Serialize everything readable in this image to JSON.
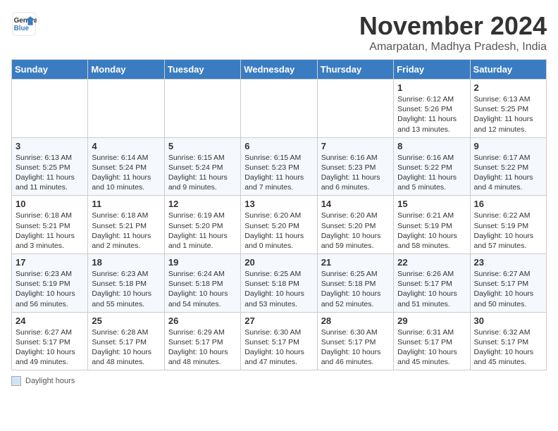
{
  "header": {
    "logo_line1": "General",
    "logo_line2": "Blue",
    "title": "November 2024",
    "subtitle": "Amarpatan, Madhya Pradesh, India"
  },
  "weekdays": [
    "Sunday",
    "Monday",
    "Tuesday",
    "Wednesday",
    "Thursday",
    "Friday",
    "Saturday"
  ],
  "weeks": [
    [
      {
        "day": "",
        "info": ""
      },
      {
        "day": "",
        "info": ""
      },
      {
        "day": "",
        "info": ""
      },
      {
        "day": "",
        "info": ""
      },
      {
        "day": "",
        "info": ""
      },
      {
        "day": "1",
        "info": "Sunrise: 6:12 AM\nSunset: 5:26 PM\nDaylight: 11 hours and 13 minutes."
      },
      {
        "day": "2",
        "info": "Sunrise: 6:13 AM\nSunset: 5:25 PM\nDaylight: 11 hours and 12 minutes."
      }
    ],
    [
      {
        "day": "3",
        "info": "Sunrise: 6:13 AM\nSunset: 5:25 PM\nDaylight: 11 hours and 11 minutes."
      },
      {
        "day": "4",
        "info": "Sunrise: 6:14 AM\nSunset: 5:24 PM\nDaylight: 11 hours and 10 minutes."
      },
      {
        "day": "5",
        "info": "Sunrise: 6:15 AM\nSunset: 5:24 PM\nDaylight: 11 hours and 9 minutes."
      },
      {
        "day": "6",
        "info": "Sunrise: 6:15 AM\nSunset: 5:23 PM\nDaylight: 11 hours and 7 minutes."
      },
      {
        "day": "7",
        "info": "Sunrise: 6:16 AM\nSunset: 5:23 PM\nDaylight: 11 hours and 6 minutes."
      },
      {
        "day": "8",
        "info": "Sunrise: 6:16 AM\nSunset: 5:22 PM\nDaylight: 11 hours and 5 minutes."
      },
      {
        "day": "9",
        "info": "Sunrise: 6:17 AM\nSunset: 5:22 PM\nDaylight: 11 hours and 4 minutes."
      }
    ],
    [
      {
        "day": "10",
        "info": "Sunrise: 6:18 AM\nSunset: 5:21 PM\nDaylight: 11 hours and 3 minutes."
      },
      {
        "day": "11",
        "info": "Sunrise: 6:18 AM\nSunset: 5:21 PM\nDaylight: 11 hours and 2 minutes."
      },
      {
        "day": "12",
        "info": "Sunrise: 6:19 AM\nSunset: 5:20 PM\nDaylight: 11 hours and 1 minute."
      },
      {
        "day": "13",
        "info": "Sunrise: 6:20 AM\nSunset: 5:20 PM\nDaylight: 11 hours and 0 minutes."
      },
      {
        "day": "14",
        "info": "Sunrise: 6:20 AM\nSunset: 5:20 PM\nDaylight: 10 hours and 59 minutes."
      },
      {
        "day": "15",
        "info": "Sunrise: 6:21 AM\nSunset: 5:19 PM\nDaylight: 10 hours and 58 minutes."
      },
      {
        "day": "16",
        "info": "Sunrise: 6:22 AM\nSunset: 5:19 PM\nDaylight: 10 hours and 57 minutes."
      }
    ],
    [
      {
        "day": "17",
        "info": "Sunrise: 6:23 AM\nSunset: 5:19 PM\nDaylight: 10 hours and 56 minutes."
      },
      {
        "day": "18",
        "info": "Sunrise: 6:23 AM\nSunset: 5:18 PM\nDaylight: 10 hours and 55 minutes."
      },
      {
        "day": "19",
        "info": "Sunrise: 6:24 AM\nSunset: 5:18 PM\nDaylight: 10 hours and 54 minutes."
      },
      {
        "day": "20",
        "info": "Sunrise: 6:25 AM\nSunset: 5:18 PM\nDaylight: 10 hours and 53 minutes."
      },
      {
        "day": "21",
        "info": "Sunrise: 6:25 AM\nSunset: 5:18 PM\nDaylight: 10 hours and 52 minutes."
      },
      {
        "day": "22",
        "info": "Sunrise: 6:26 AM\nSunset: 5:17 PM\nDaylight: 10 hours and 51 minutes."
      },
      {
        "day": "23",
        "info": "Sunrise: 6:27 AM\nSunset: 5:17 PM\nDaylight: 10 hours and 50 minutes."
      }
    ],
    [
      {
        "day": "24",
        "info": "Sunrise: 6:27 AM\nSunset: 5:17 PM\nDaylight: 10 hours and 49 minutes."
      },
      {
        "day": "25",
        "info": "Sunrise: 6:28 AM\nSunset: 5:17 PM\nDaylight: 10 hours and 48 minutes."
      },
      {
        "day": "26",
        "info": "Sunrise: 6:29 AM\nSunset: 5:17 PM\nDaylight: 10 hours and 48 minutes."
      },
      {
        "day": "27",
        "info": "Sunrise: 6:30 AM\nSunset: 5:17 PM\nDaylight: 10 hours and 47 minutes."
      },
      {
        "day": "28",
        "info": "Sunrise: 6:30 AM\nSunset: 5:17 PM\nDaylight: 10 hours and 46 minutes."
      },
      {
        "day": "29",
        "info": "Sunrise: 6:31 AM\nSunset: 5:17 PM\nDaylight: 10 hours and 45 minutes."
      },
      {
        "day": "30",
        "info": "Sunrise: 6:32 AM\nSunset: 5:17 PM\nDaylight: 10 hours and 45 minutes."
      }
    ]
  ],
  "legend_label": "Daylight hours"
}
